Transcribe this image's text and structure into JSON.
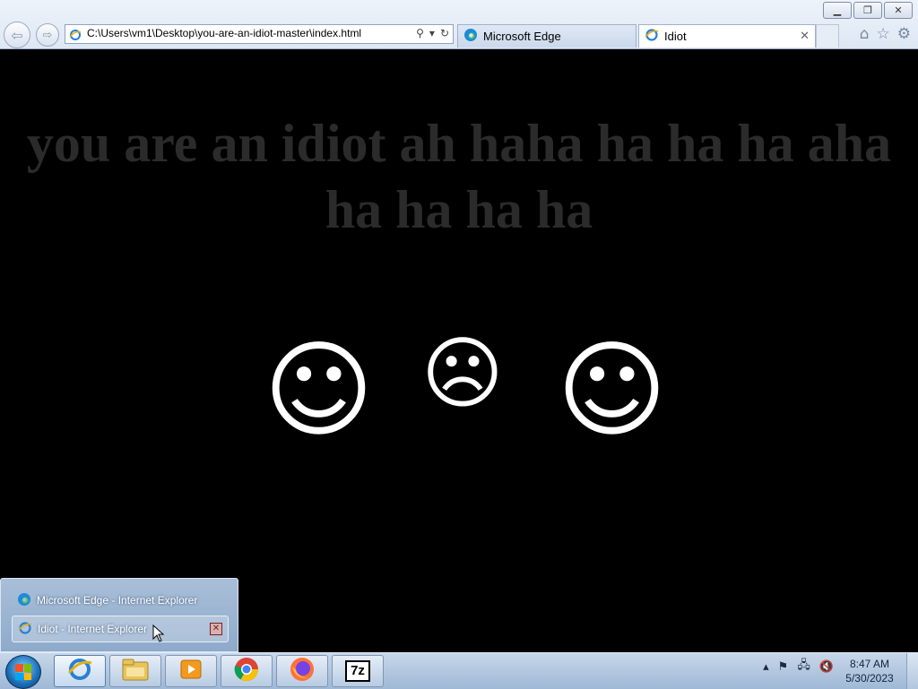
{
  "window": {
    "minimize_icon": "minimize-icon",
    "restore_icon": "restore-icon",
    "close_icon": "close-icon"
  },
  "addressbar": {
    "url": "C:\\Users\\vm1\\Desktop\\you-are-an-idiot-master\\index.html"
  },
  "tabs": [
    {
      "label": "Microsoft Edge",
      "active": false
    },
    {
      "label": "Idiot",
      "active": true
    }
  ],
  "page": {
    "headline": "you are an idiot ah haha ha ha ha aha ha ha ha ha",
    "faces": [
      "☺",
      "☹",
      "☺"
    ]
  },
  "taskbar_popup": {
    "items": [
      {
        "label": "Microsoft Edge - Internet Explorer"
      },
      {
        "label": "Idiot - Internet Explorer"
      }
    ]
  },
  "taskbar": {
    "apps": [
      "Internet Explorer",
      "Windows Explorer",
      "Windows Media Player",
      "Google Chrome",
      "Firefox",
      "7-Zip"
    ],
    "sevenzip_label": "7z"
  },
  "clock": {
    "time": "8:47 AM",
    "date": "5/30/2023"
  },
  "colors": {
    "page_background": "#000000",
    "headline": "#2b2b2b",
    "faces": "#ffffff"
  }
}
